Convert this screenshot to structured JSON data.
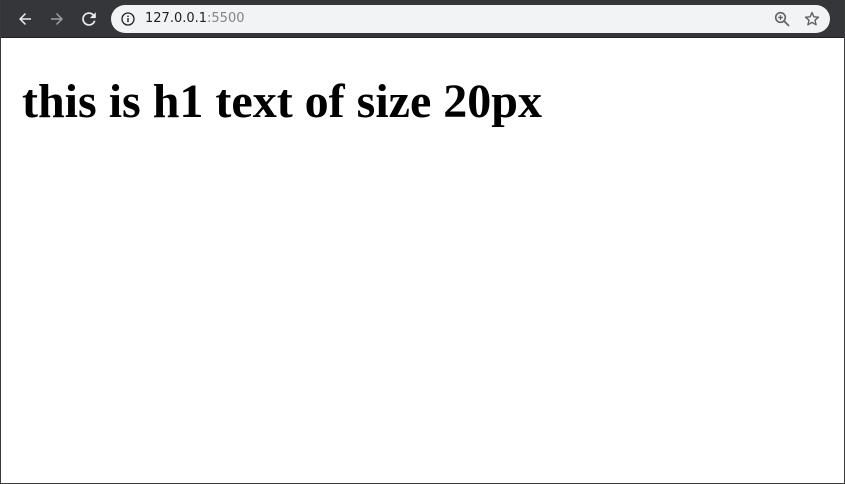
{
  "browser": {
    "url_host": "127.0.0.1",
    "url_port": ":5500",
    "icons": {
      "back": "arrow-left-icon",
      "forward": "arrow-right-icon",
      "reload": "reload-icon",
      "site_info": "info-icon",
      "zoom": "zoom-in-icon",
      "bookmark": "star-icon"
    },
    "colors": {
      "toolbar": "#35363a",
      "omnibox": "#f1f3f4",
      "url_text": "#202124",
      "url_port_text": "#80868b"
    }
  },
  "page": {
    "heading": "this is h1 text of size 20px"
  }
}
